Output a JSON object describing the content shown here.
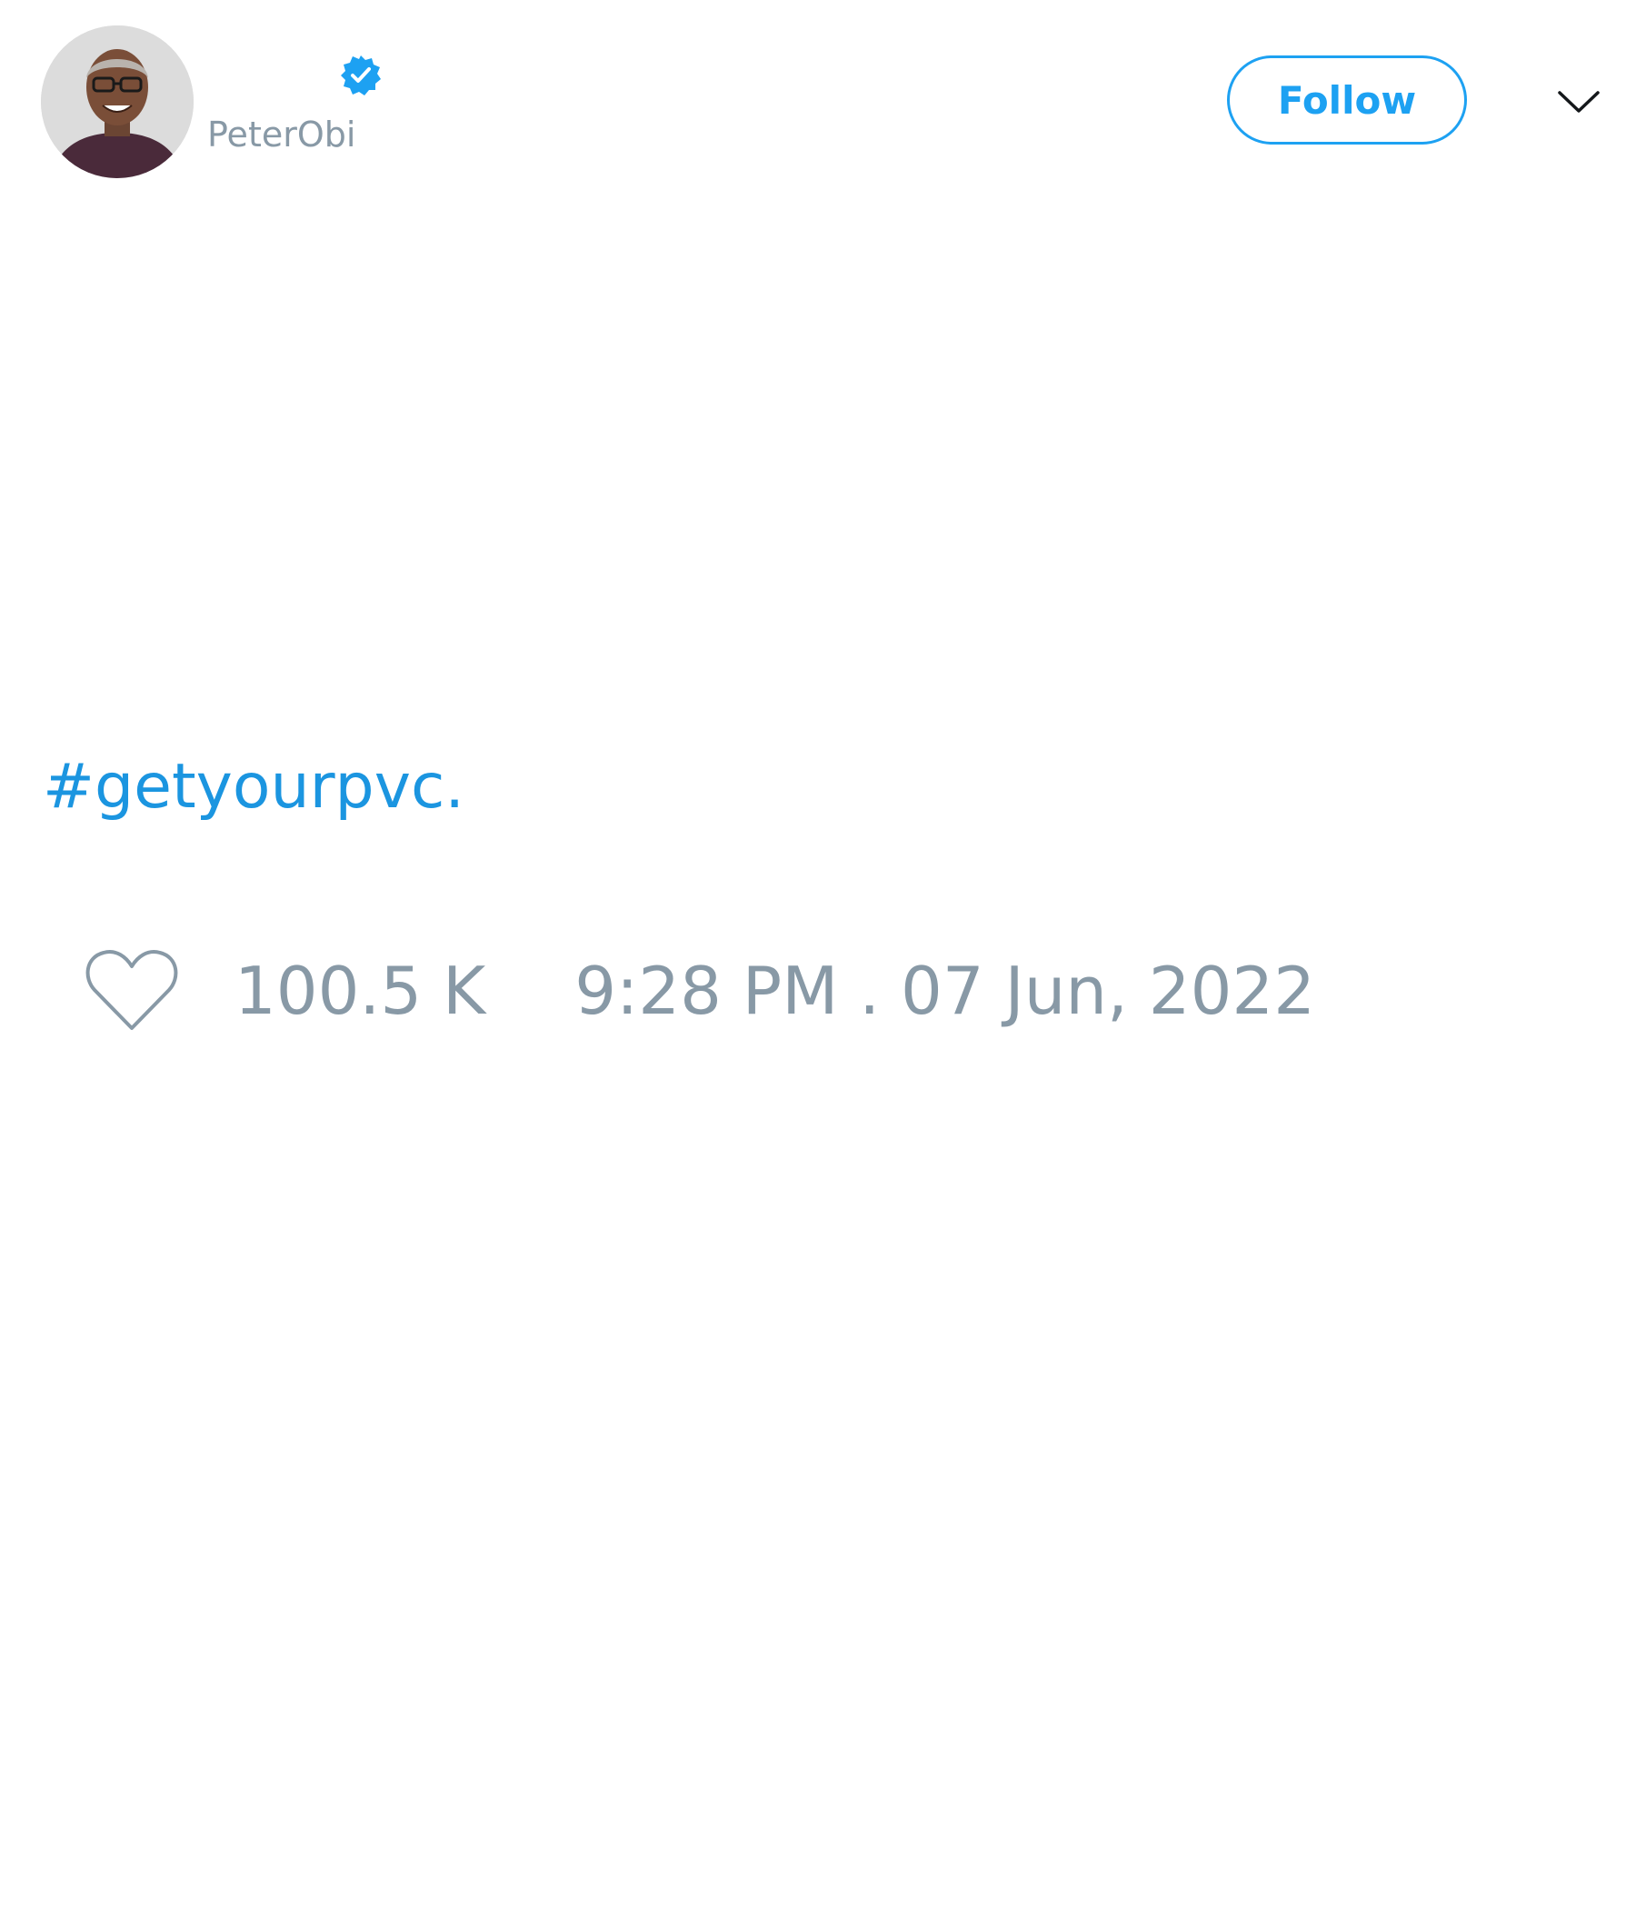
{
  "author": {
    "display_name": "",
    "handle": "PeterObi",
    "verified": true,
    "avatar_icon": "profile-photo"
  },
  "actions": {
    "follow_label": "Follow",
    "menu_icon": "chevron-down-icon"
  },
  "tweet": {
    "text": "#getyourpvc."
  },
  "stats": {
    "like_icon": "heart-outline-icon",
    "likes": "100.5 K",
    "timestamp": "9:28 PM . 07 Jun, 2022"
  },
  "colors": {
    "accent": "#1da1f2",
    "hashtag": "#1b95e0",
    "muted": "#8899a6",
    "background": "#ffffff"
  }
}
